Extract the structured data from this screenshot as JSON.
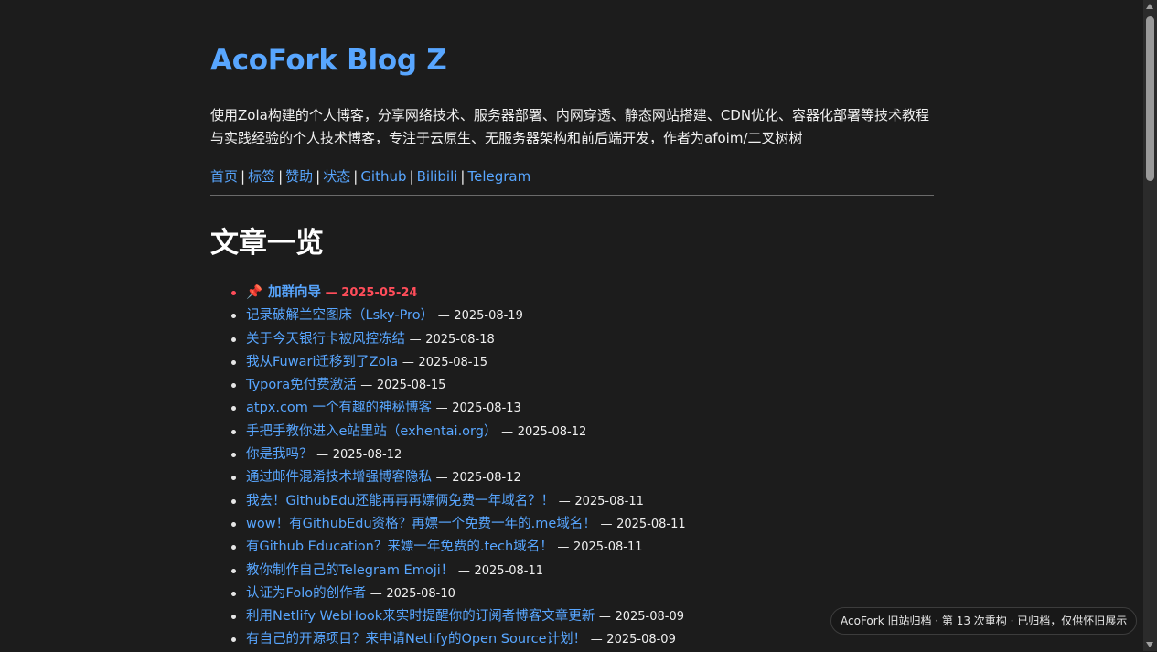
{
  "site": {
    "title": "AcoFork Blog Z",
    "description": "使用Zola构建的个人博客，分享网络技术、服务器部署、内网穿透、静态网站搭建、CDN优化、容器化部署等技术教程与实践经验的个人技术博客，专注于云原生、无服务器架构和前后端开发，作者为afoim/二叉树树"
  },
  "nav": {
    "items": [
      {
        "label": "首页"
      },
      {
        "label": "标签"
      },
      {
        "label": "赞助"
      },
      {
        "label": "状态"
      },
      {
        "label": "Github"
      },
      {
        "label": "Bilibili"
      },
      {
        "label": "Telegram"
      }
    ],
    "separator": "|"
  },
  "posts_section": {
    "title": "文章一览",
    "date_prefix": "—",
    "pinned_icon": "📌",
    "posts": [
      {
        "title": "加群向导",
        "date": "2025-05-24",
        "pinned": true
      },
      {
        "title": "记录破解兰空图床（Lsky-Pro）",
        "date": "2025-08-19"
      },
      {
        "title": "关于今天银行卡被风控冻结",
        "date": "2025-08-18"
      },
      {
        "title": "我从Fuwari迁移到了Zola",
        "date": "2025-08-15"
      },
      {
        "title": "Typora免付费激活",
        "date": "2025-08-15"
      },
      {
        "title": "atpx.com 一个有趣的神秘博客",
        "date": "2025-08-13"
      },
      {
        "title": "手把手教你进入e站里站（exhentai.org）",
        "date": "2025-08-12"
      },
      {
        "title": "你是我吗？",
        "date": "2025-08-12"
      },
      {
        "title": "通过邮件混淆技术增强博客隐私",
        "date": "2025-08-12"
      },
      {
        "title": "我去！GithubEdu还能再再再嫖俩免费一年域名？！",
        "date": "2025-08-11"
      },
      {
        "title": "wow！有GithubEdu资格？再嫖一个免费一年的.me域名！",
        "date": "2025-08-11"
      },
      {
        "title": "有Github Education？来嫖一年免费的.tech域名！",
        "date": "2025-08-11"
      },
      {
        "title": "教你制作自己的Telegram Emoji！",
        "date": "2025-08-11"
      },
      {
        "title": "认证为Folo的创作者",
        "date": "2025-08-10"
      },
      {
        "title": "利用Netlify WebHook来实时提醒你的订阅者博客文章更新",
        "date": "2025-08-09"
      },
      {
        "title": "有自己的开源项目？来申请Netlify的Open Source计划！",
        "date": "2025-08-09"
      }
    ]
  },
  "archive_badge": {
    "text": "AcoFork 旧站归档 · 第 13 次重构 · 已归档，仅供怀旧展示"
  },
  "colors": {
    "background": "#1c1c1c",
    "link": "#58a6ff",
    "pinned": "#ff4d5a",
    "text": "#f0f0f0"
  }
}
